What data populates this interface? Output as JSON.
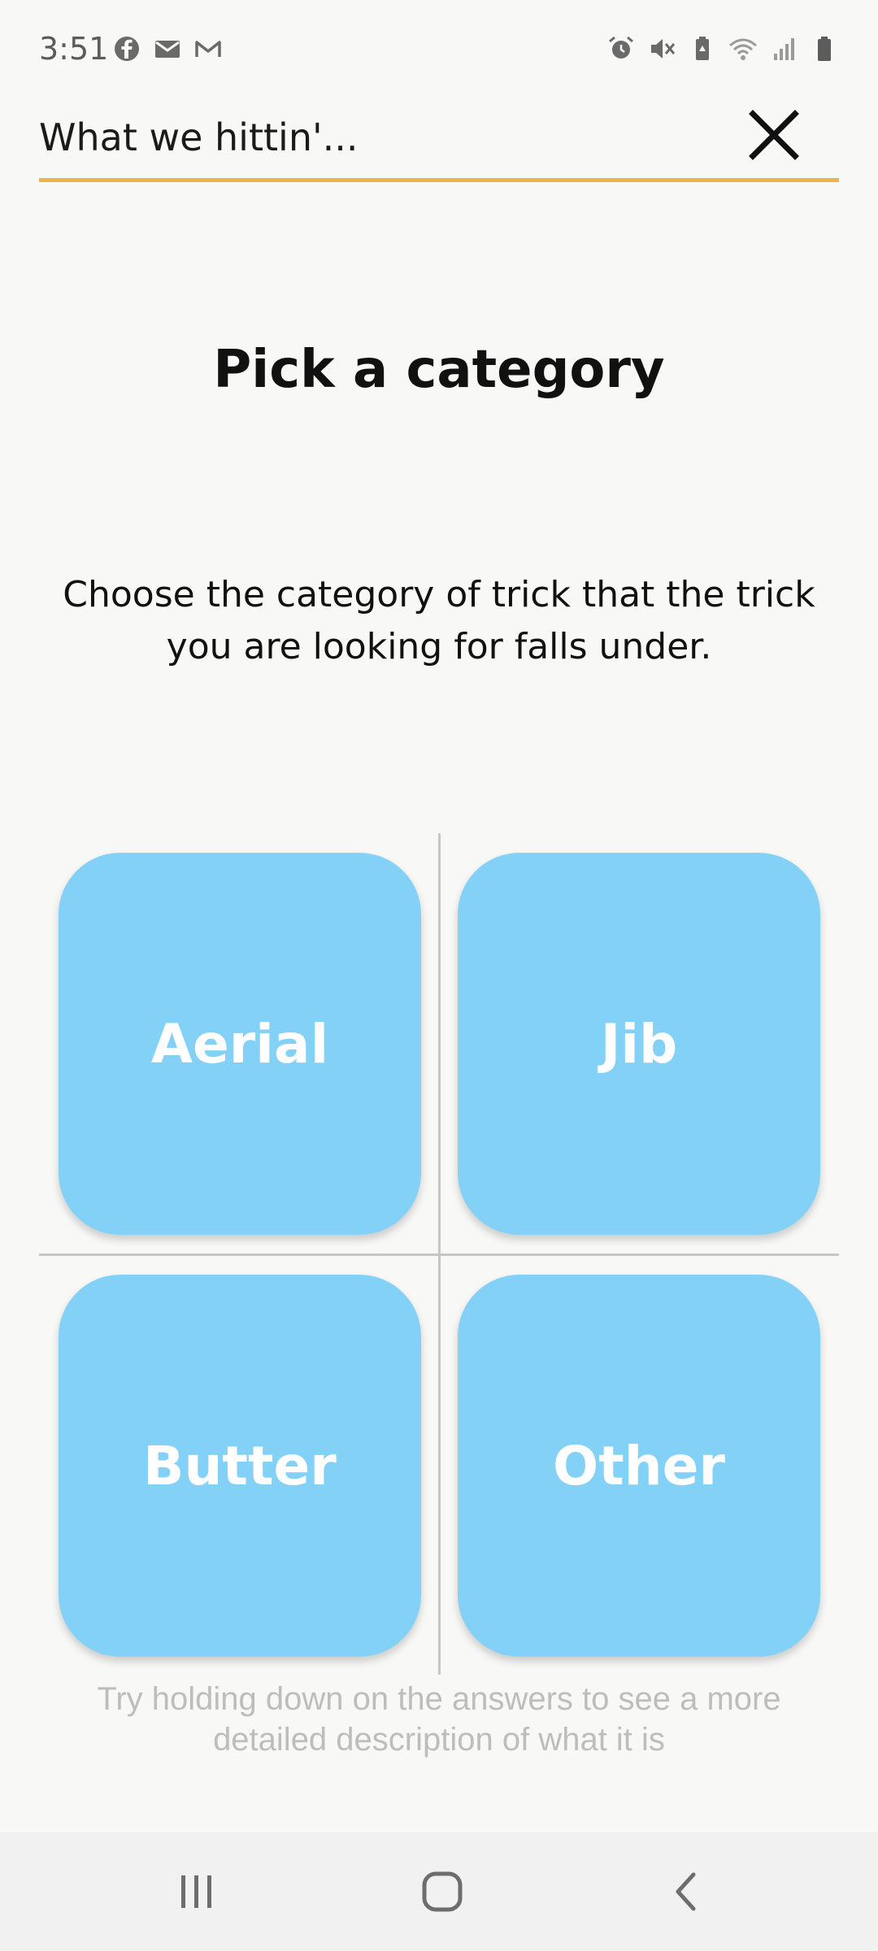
{
  "status_bar": {
    "time": "3:51",
    "left_icons": [
      "facebook-icon",
      "email-icon",
      "gmail-icon"
    ],
    "right_icons": [
      "alarm-icon",
      "mute-icon",
      "battery-saver-icon",
      "wifi-icon",
      "signal-icon",
      "battery-icon"
    ]
  },
  "search": {
    "value": "What we hittin'...",
    "close_icon": "close-icon"
  },
  "page": {
    "title": "Pick a category",
    "description": "Choose the category of trick that the trick you are looking for falls under."
  },
  "categories": [
    {
      "label": "Aerial"
    },
    {
      "label": "Jib"
    },
    {
      "label": "Butter"
    },
    {
      "label": "Other"
    }
  ],
  "hint": "Try holding down on the answers to see a more detailed description of what it is",
  "nav_bar": {
    "icons": [
      "recents-icon",
      "home-icon",
      "back-icon"
    ]
  },
  "colors": {
    "accent": "#f0b24a",
    "card": "#84d1f7",
    "background": "#f8f8f7",
    "hint_text": "#bdbdbd"
  }
}
